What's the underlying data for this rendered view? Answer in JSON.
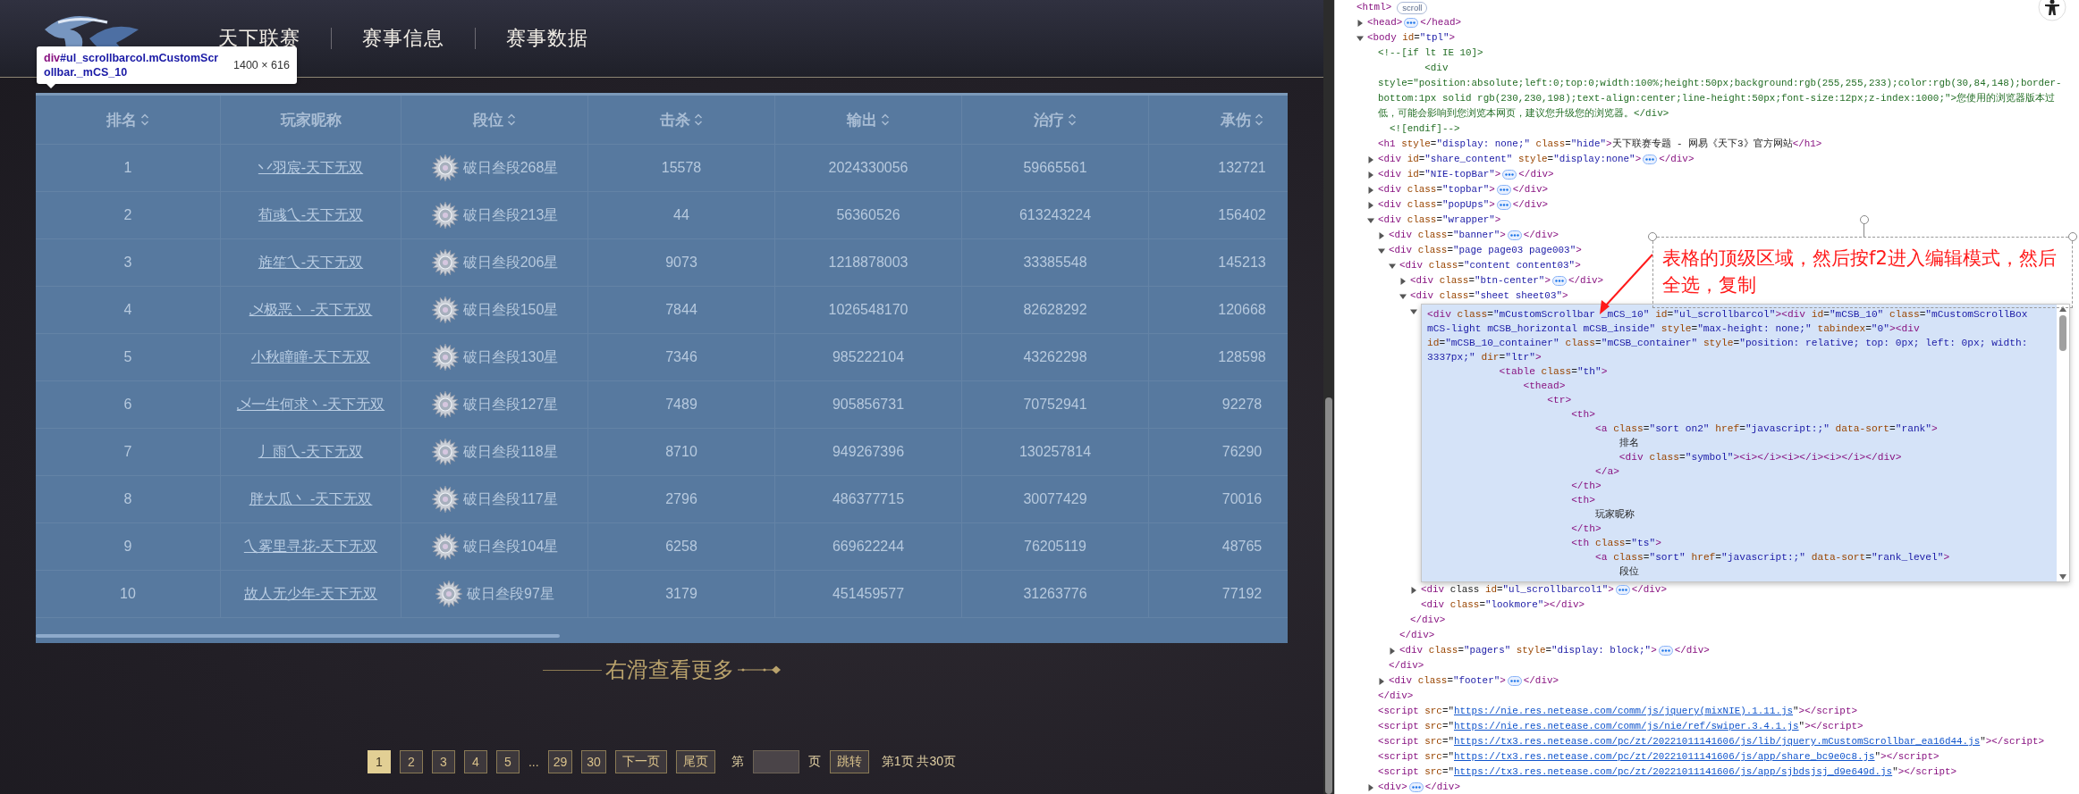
{
  "page": {
    "nav": {
      "items": [
        {
          "label": "天下联赛"
        },
        {
          "label": "赛事信息"
        },
        {
          "label": "赛事数据"
        }
      ]
    },
    "inspect_tooltip": {
      "tag": "div",
      "selector": "#ul_scrollbarcol.mCustomScrollbar._mCS_10",
      "size": "1400 × 616"
    },
    "table": {
      "columns": [
        {
          "label": "排名",
          "sortable": true
        },
        {
          "label": "玩家昵称",
          "sortable": false
        },
        {
          "label": "段位",
          "sortable": true
        },
        {
          "label": "击杀",
          "sortable": true
        },
        {
          "label": "输出",
          "sortable": true
        },
        {
          "label": "治疗",
          "sortable": true
        },
        {
          "label": "承伤",
          "sortable": true
        }
      ],
      "rows": [
        {
          "rank": "1",
          "name": "丷羽宸-天下无双",
          "tier": "破日叁段268星",
          "kills": "15578",
          "output": "2024330056",
          "healing": "59665561",
          "damage_taken": "132721"
        },
        {
          "rank": "2",
          "name": "荀彧乀-天下无双",
          "tier": "破日叁段213星",
          "kills": "44",
          "output": "56360526",
          "healing": "613243224",
          "damage_taken": "156402"
        },
        {
          "rank": "3",
          "name": "旌笙乀-天下无双",
          "tier": "破日叁段206星",
          "kills": "9073",
          "output": "1218878003",
          "healing": "33385548",
          "damage_taken": "145213"
        },
        {
          "rank": "4",
          "name": "乄极恶丶 -天下无双",
          "tier": "破日叁段150星",
          "kills": "7844",
          "output": "1026548170",
          "healing": "82628292",
          "damage_taken": "120668"
        },
        {
          "rank": "5",
          "name": "小秋瞳瞳-天下无双",
          "tier": "破日叁段130星",
          "kills": "7346",
          "output": "985222104",
          "healing": "43262298",
          "damage_taken": "128598"
        },
        {
          "rank": "6",
          "name": "乄一生何求丶-天下无双",
          "tier": "破日叁段127星",
          "kills": "7489",
          "output": "905856731",
          "healing": "70752941",
          "damage_taken": "92278"
        },
        {
          "rank": "7",
          "name": "丿雨乀-天下无双",
          "tier": "破日叁段118星",
          "kills": "8710",
          "output": "949267396",
          "healing": "130257814",
          "damage_taken": "76290"
        },
        {
          "rank": "8",
          "name": "胖大瓜丶 -天下无双",
          "tier": "破日叁段117星",
          "kills": "2796",
          "output": "486377715",
          "healing": "30077429",
          "damage_taken": "70016"
        },
        {
          "rank": "9",
          "name": "乀雾里寻花-天下无双",
          "tier": "破日叁段104星",
          "kills": "6258",
          "output": "669622244",
          "healing": "76205119",
          "damage_taken": "48765"
        },
        {
          "rank": "10",
          "name": "故人无少年-天下无双",
          "tier": "破日叁段97星",
          "kills": "3179",
          "output": "451459577",
          "healing": "31263776",
          "damage_taken": "77192"
        }
      ]
    },
    "swipe_hint": "右滑查看更多",
    "pagination": {
      "items": [
        {
          "kind": "page",
          "label": "1",
          "selected": true
        },
        {
          "kind": "page",
          "label": "2",
          "selected": false
        },
        {
          "kind": "page",
          "label": "3",
          "selected": false
        },
        {
          "kind": "page",
          "label": "4",
          "selected": false
        },
        {
          "kind": "page",
          "label": "5",
          "selected": false
        },
        {
          "kind": "ellipsis",
          "label": "..."
        },
        {
          "kind": "page",
          "label": "29",
          "selected": false
        },
        {
          "kind": "page",
          "label": "30",
          "selected": false
        },
        {
          "kind": "nav",
          "label": "下一页"
        },
        {
          "kind": "nav",
          "label": "尾页"
        }
      ],
      "jump": {
        "prefix": "第",
        "suffix": "页",
        "button": "跳转"
      },
      "summary": "第1页 共30页"
    }
  },
  "devtools": {
    "dom_tree": {
      "kind": "root",
      "open": "<html>",
      "badge": "scroll",
      "children": [
        {
          "kind": "element",
          "open": "<head>",
          "close": "</head>",
          "expanded": false
        },
        {
          "kind": "element",
          "open": "<body id=\"tpl\">",
          "expanded": true,
          "children": [
            {
              "kind": "comment",
              "lines": [
                "<!--[if lt IE 10]>",
                "        <div",
                "style=\"position:absolute;left:0;top:0;width:100%;height:50px;background:rgb(255,255,233);color:rgb(30,84,148);border-bottom:1px solid rgb(230,230,198);text-align:center;line-height:50px;font-size:12px;z-index:1000;\">您使用的浏览器版本过低，可能会影响到您浏览本网页，建议您升级您的浏览器。</div>",
                "  <![endif]-->"
              ]
            },
            {
              "kind": "line",
              "text": "<h1 style=\"display: none;\" class=\"hide\">天下联赛专题 - 网易《天下3》官方网站</h1>"
            },
            {
              "kind": "element",
              "open": "<div id=\"share_content\" style=\"display:none\">",
              "close": "</div>",
              "expanded": false
            },
            {
              "kind": "element",
              "open": "<div id=\"NIE-topBar\">",
              "close": "</div>",
              "expanded": false
            },
            {
              "kind": "element",
              "open": "<div class=\"topbar\">",
              "close": "</div>",
              "expanded": false
            },
            {
              "kind": "element",
              "open": "<div class=\"popUps\">",
              "close": "</div>",
              "expanded": false
            },
            {
              "kind": "element",
              "open": "<div class=\"wrapper\">",
              "close": "</div>",
              "expanded": true,
              "children": [
                {
                  "kind": "element",
                  "open": "<div class=\"banner\">",
                  "close": "</div>",
                  "expanded": false
                },
                {
                  "kind": "element",
                  "open": "<div class=\"page page03 page003\">",
                  "close": "</div>",
                  "expanded": true,
                  "children": [
                    {
                      "kind": "element",
                      "open": "<div class=\"content content03\">",
                      "close": "</div>",
                      "expanded": true,
                      "children": [
                        {
                          "kind": "element",
                          "open": "<div class=\"btn-center\">",
                          "close": "</div>",
                          "expanded": false
                        },
                        {
                          "kind": "element",
                          "open": "<div class=\"sheet sheet03\">",
                          "close": "</div>",
                          "expanded": true,
                          "children": [
                            {
                              "kind": "editor",
                              "expanded": true,
                              "lines": [
                                "<div class=\"mCustomScrollbar _mCS_10\" id=\"ul_scrollbarcol\"><div id=\"mCSB_10\" class=\"mCustomScrollBox mCS-light mCSB_horizontal mCSB_inside\" style=\"max-height: none;\" tabindex=\"0\"><div id=\"mCSB_10_container\" class=\"mCSB_container\" style=\"position: relative; top: 0px; left: 0px; width: 3337px;\" dir=\"ltr\">",
                                "            <table class=\"th\">",
                                "                <thead>",
                                "                    <tr>",
                                "                        <th>",
                                "                            <a class=\"sort on2\" href=\"javascript:;\" data-sort=\"rank\">",
                                "                                排名",
                                "                                <div class=\"symbol\"><i></i><i></i><i></i></div>",
                                "                            </a>",
                                "                        </th>",
                                "                        <th>",
                                "                            玩家昵称",
                                "                        </th>",
                                "                        <th class=\"ts\">",
                                "                            <a class=\"sort\" href=\"javascript:;\" data-sort=\"rank_level\">",
                                "                                段位"
                              ]
                            },
                            {
                              "kind": "element",
                              "open": "<div class id=\"ul_scrollbarcol1\">",
                              "close": "</div>",
                              "expanded": false
                            },
                            {
                              "kind": "line",
                              "text": "<div class=\"lookmore\"></div>"
                            }
                          ]
                        }
                      ]
                    },
                    {
                      "kind": "element",
                      "open": "<div class=\"pagers\" style=\"display: block;\">",
                      "close": "</div>",
                      "expanded": false
                    }
                  ]
                },
                {
                  "kind": "element",
                  "open": "<div class=\"footer\">",
                  "close": "</div>",
                  "expanded": false
                }
              ]
            },
            {
              "kind": "script",
              "open": "<script src=\"",
              "url": "https://nie.res.netease.com/comm/js/jquery(mixNIE).1.11.js",
              "close": "\"></script>"
            },
            {
              "kind": "script",
              "open": "<script src=\"",
              "url": "https://nie.res.netease.com/comm/js/nie/ref/swiper.3.4.1.js",
              "close": "\"></script>"
            },
            {
              "kind": "script",
              "open": "<script src=\"",
              "url": "https://tx3.res.netease.com/pc/zt/20221011141606/js/lib/jquery.mCustomScrollbar_ea16d44.js",
              "close": "\"></script>"
            },
            {
              "kind": "script",
              "open": "<script src=\"",
              "url": "https://tx3.res.netease.com/pc/zt/20221011141606/js/app/share_bc9e0c8.js",
              "close": "\"></script>"
            },
            {
              "kind": "script",
              "open": "<script src=\"",
              "url": "https://tx3.res.netease.com/pc/zt/20221011141606/js/app/sjbdsjsj_d9e649d.js",
              "close": "\"></script>"
            },
            {
              "kind": "element",
              "open": "<div>",
              "close": "</div>",
              "expanded": false
            }
          ]
        }
      ]
    }
  },
  "annotation": {
    "text": "表格的顶级区域，然后按f2进入编辑模式，然后全选，复制"
  }
}
